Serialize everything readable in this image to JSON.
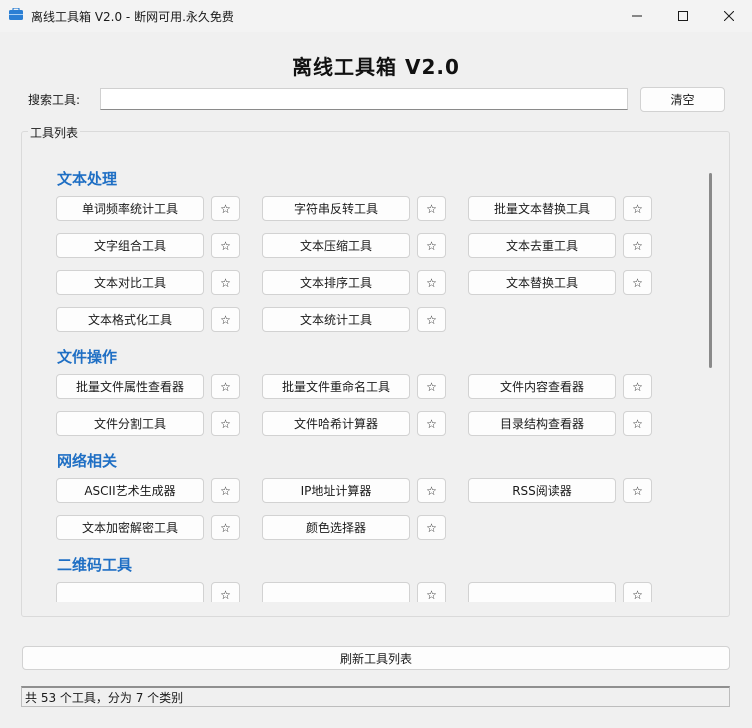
{
  "window": {
    "title": "离线工具箱 V2.0 - 断网可用.永久免费",
    "minimize_icon": "minimize-icon",
    "maximize_icon": "maximize-icon",
    "close_icon": "close-icon"
  },
  "heading": "离线工具箱  V2.0",
  "search": {
    "label": "搜索工具:",
    "value": "",
    "placeholder": "",
    "clear_label": "清空"
  },
  "tool_list": {
    "group_label": "工具列表",
    "star_label": "☆",
    "categories": [
      {
        "name": "文本处理",
        "tools": [
          "单词频率统计工具",
          "字符串反转工具",
          "批量文本替换工具",
          "文字组合工具",
          "文本压缩工具",
          "文本去重工具",
          "文本对比工具",
          "文本排序工具",
          "文本替换工具",
          "文本格式化工具",
          "文本统计工具"
        ]
      },
      {
        "name": "文件操作",
        "tools": [
          "批量文件属性查看器",
          "批量文件重命名工具",
          "文件内容查看器",
          "文件分割工具",
          "文件哈希计算器",
          "目录结构查看器"
        ]
      },
      {
        "name": "网络相关",
        "tools": [
          "ASCII艺术生成器",
          "IP地址计算器",
          "RSS阅读器",
          "文本加密解密工具",
          "颜色选择器"
        ]
      },
      {
        "name": "二维码工具",
        "tools": [
          "",
          "",
          ""
        ]
      }
    ]
  },
  "refresh_label": "刷新工具列表",
  "status": "共 53 个工具，分为 7 个类别",
  "colors": {
    "category_title": "#1f6fc4",
    "window_bg": "#f0f0f0",
    "app_icon": "#2b7fd4"
  }
}
